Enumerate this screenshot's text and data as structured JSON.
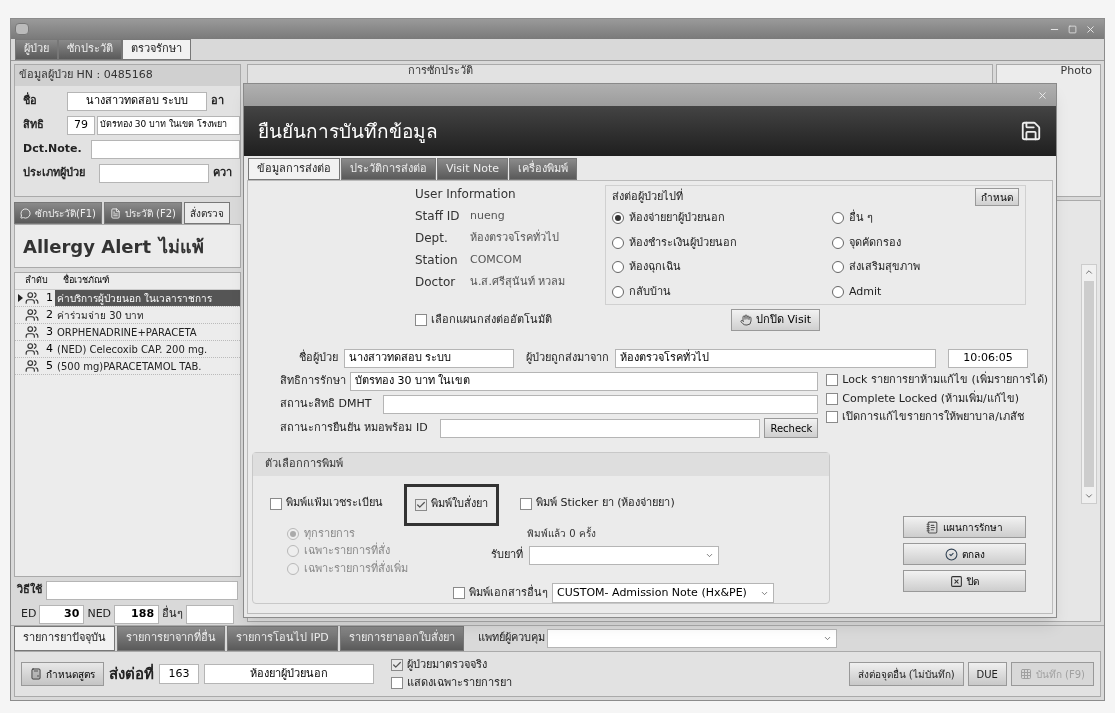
{
  "main_tabs": [
    {
      "label": "ผู้ป่วย",
      "selected": false
    },
    {
      "label": "ซักประวัติ",
      "selected": false
    },
    {
      "label": "ตรวจรักษา",
      "selected": true
    }
  ],
  "patient": {
    "title": "ข้อมูลผู้ป่วย HN : 0485168",
    "name_label": "ชื่อ",
    "name": "นางสาวทดสอบ ระบบ",
    "age_label": "อา",
    "right_label": "สิทธิ",
    "right_code": "79",
    "right_name": "บัตรทอง 30 บาท ในเขต โรงพยา",
    "note_label": "Dct.Note.",
    "type_label": "ประเภทผู้ป่วย",
    "cut_label": "ควา"
  },
  "history_title": "การซักประวัติ",
  "photo_label": "Photo",
  "sub_tabs": [
    {
      "label": "ซักประวัติ(F1)",
      "selected": false
    },
    {
      "label": "ประวัติ (F2)",
      "selected": false
    },
    {
      "label": "สั่งตรวจ",
      "selected": true
    }
  ],
  "allergy": {
    "label": "Allergy Alert",
    "value": "ไม่แพ้"
  },
  "orders": {
    "columns": [
      "ลำดับ",
      "ชื่อเวชภัณฑ์"
    ],
    "rows": [
      {
        "no": "1",
        "name": "ค่าบริการผู้ป่วยนอก ในเวลาราชการ",
        "selected": true
      },
      {
        "no": "2",
        "name": "ค่าร่วมจ่าย 30 บาท",
        "selected": false
      },
      {
        "no": "3",
        "name": "ORPHENADRINE+PARACETA",
        "selected": false
      },
      {
        "no": "4",
        "name": "(NED) Celecoxib CAP. 200 mg.",
        "selected": false
      },
      {
        "no": "5",
        "name": "(500 mg)PARACETAMOL TAB.",
        "selected": false
      }
    ]
  },
  "usage": {
    "label": "วิธีใช้"
  },
  "ed": {
    "ed_label": "ED",
    "ed": "30",
    "ned_label": "NED",
    "ned": "188",
    "other_label": "อื่นๆ"
  },
  "bottom_tabs": [
    {
      "label": "รายการยาปัจจุบัน",
      "selected": true
    },
    {
      "label": "รายการยาจากที่อื่น",
      "selected": false
    },
    {
      "label": "รายการโอนไป IPD",
      "selected": false
    },
    {
      "label": "รายการยาออกใบสั่งยา",
      "selected": false
    }
  ],
  "controller": {
    "label": "แพทย์ผู้ควบคุม"
  },
  "footer": {
    "formula_button": "กำหนดสูตร",
    "refer_label": "ส่งต่อที่",
    "refer_code": "163",
    "refer_name": "ห้องยาผู้ป่วยนอก",
    "checks": [
      {
        "label": "ผู้ป่วยมาตรวจจริง",
        "checked": true
      },
      {
        "label": "แสดงเฉพาะรายการยา",
        "checked": false
      }
    ],
    "buttons": [
      {
        "label": "ส่งต่อจุดอื่น (ไม่บันทึก)",
        "disabled": false
      },
      {
        "label": "DUE",
        "disabled": false
      },
      {
        "label": "บันทึก (F9)",
        "disabled": true
      }
    ]
  },
  "dialog": {
    "title": "ยืนยันการบันทึกข้อมูล",
    "tabs": [
      {
        "label": "ข้อมูลการส่งต่อ",
        "selected": true
      },
      {
        "label": "ประวัติการส่งต่อ",
        "selected": false
      },
      {
        "label": "Visit Note",
        "selected": false
      },
      {
        "label": "เครื่องพิมพ์",
        "selected": false
      }
    ],
    "user_info": {
      "title": "User Information",
      "rows": [
        {
          "label": "Staff ID",
          "value": "nueng"
        },
        {
          "label": "Dept.",
          "value": "ห้องตรวจโรคทั่วไป"
        },
        {
          "label": "Station",
          "value": "COMCOM"
        },
        {
          "label": "Doctor",
          "value": "น.ส.ศรีสุนันท์ หวลม"
        }
      ]
    },
    "destination": {
      "title": "ส่งต่อผู้ป่วยไปที่",
      "set_button": "กำหนด",
      "options": [
        {
          "label": "ห้องจ่ายยาผู้ป่วยนอก",
          "selected": true
        },
        {
          "label": "ห้องชำระเงินผู้ป่วยนอก",
          "selected": false
        },
        {
          "label": "ห้องฉุกเฉิน",
          "selected": false
        },
        {
          "label": "กลับบ้าน",
          "selected": false
        },
        {
          "label": "อื่น ๆ",
          "selected": false
        },
        {
          "label": "จุดคัดกรอง",
          "selected": false
        },
        {
          "label": "ส่งเสริมสุขภาพ",
          "selected": false
        },
        {
          "label": "Admit",
          "selected": false
        }
      ]
    },
    "auto_select": {
      "label": "เลือกแผนกส่งต่ออัตโนมัติ",
      "checked": false
    },
    "hide_visit_button": "ปกปิด Visit",
    "patient_name": {
      "label": "ชื่อผู้ป่วย",
      "value": "นางสาวทดสอบ ระบบ"
    },
    "sent_from": {
      "label": "ผู้ป่วยถูกส่งมาจาก",
      "value": "ห้องตรวจโรคทั่วไป"
    },
    "time": "10:06:05",
    "coverage": {
      "label": "สิทธิการรักษา",
      "value": "บัตรทอง 30 บาท ในเขต"
    },
    "dmht": {
      "label": "สถานะสิทธิ DMHT"
    },
    "mophrom": {
      "label": "สถานะการยืนยัน หมอพร้อม ID"
    },
    "recheck_button": "Recheck",
    "locks": [
      {
        "label": "Lock รายการยาห้ามแก้ไข (เพิ่มรายการได้)",
        "checked": false
      },
      {
        "label": "Complete Locked (ห้ามเพิ่ม/แก้ไข)",
        "checked": false
      },
      {
        "label": "เปิดการแก้ไขรายการให้พยาบาล/เภสัช",
        "checked": false
      }
    ],
    "print": {
      "title": "ตัวเลือกการพิมพ์",
      "options": [
        {
          "label": "พิมพ์แฟ้มเวชระเบียน",
          "checked": false,
          "highlighted": false
        },
        {
          "label": "พิมพ์ใบสั่งยา",
          "checked": true,
          "highlighted": true
        },
        {
          "label": "พิมพ์ Sticker ยา (ห้องจ่ายยา)",
          "checked": false,
          "highlighted": false
        }
      ],
      "scope": [
        {
          "label": "ทุกรายการ",
          "selected": true,
          "disabled": true
        },
        {
          "label": "เฉพาะรายการที่สั่ง",
          "selected": false,
          "disabled": true
        },
        {
          "label": "เฉพาะรายการที่สั่งเพิ่ม",
          "selected": false,
          "disabled": true
        }
      ],
      "printed_count": "พิมพ์แล้ว 0 ครั้ง",
      "pickup": {
        "label": "รับยาที่"
      },
      "other_docs": {
        "label": "พิมพ์เอกสารอื่นๆ",
        "checked": false,
        "value": "CUSTOM- Admission Note (Hx&PE)"
      }
    },
    "actions": [
      {
        "label": "แผนการรักษา"
      },
      {
        "label": "ตกลง"
      },
      {
        "label": "ปิด"
      }
    ]
  }
}
